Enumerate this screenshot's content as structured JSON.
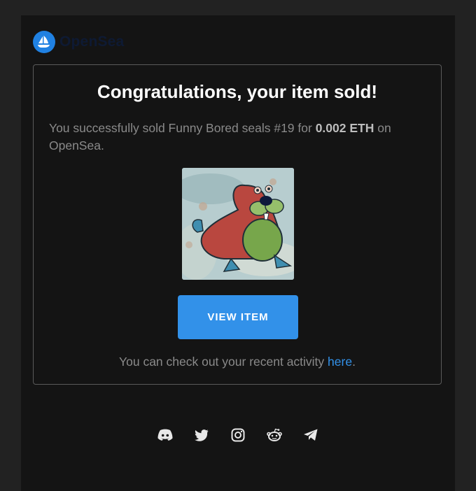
{
  "brand": {
    "name": "OpenSea",
    "logo_icon": "opensea-ship-icon"
  },
  "card": {
    "title": "Congratulations, your item sold!",
    "message_prefix": "You successfully sold Funny Bored seals #19 for ",
    "price": "0.002 ETH",
    "message_suffix": " on OpenSea.",
    "image_icon": "seal-nft-image",
    "button_label": "VIEW ITEM",
    "activity_text": "You can check out your recent activity ",
    "activity_link": "here",
    "activity_end": "."
  },
  "social": [
    "discord-icon",
    "twitter-icon",
    "instagram-icon",
    "reddit-icon",
    "telegram-icon"
  ],
  "colors": {
    "accent": "#3291e9",
    "brand": "#2081E2",
    "background": "#141414",
    "page": "#222222"
  }
}
